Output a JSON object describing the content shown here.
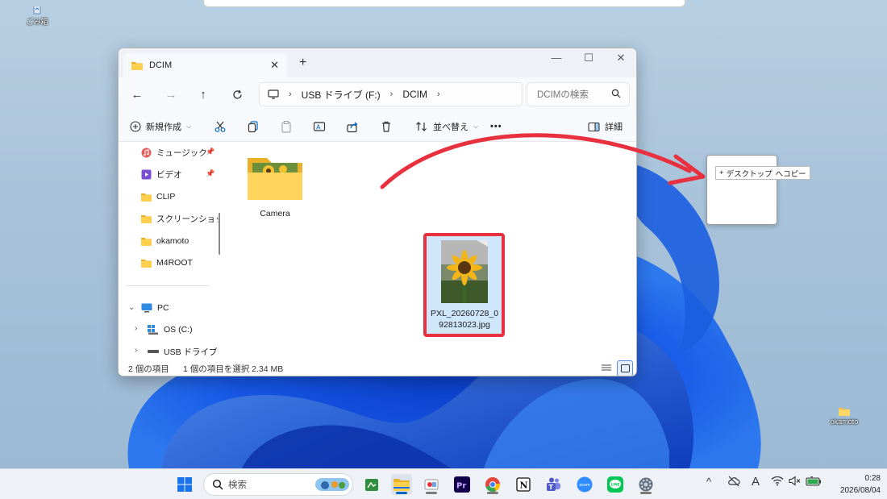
{
  "desktop": {
    "recycle_bin_label": "ごみ箱",
    "folder_label": "okamoto"
  },
  "explorer": {
    "tab_title": "DCIM",
    "tab_close": "✕",
    "new_tab": "+",
    "address": [
      "USB ドライブ (F:)",
      "DCIM"
    ],
    "search_placeholder": "DCIMの検索",
    "commands": {
      "new": "新規作成",
      "sort": "並べ替え",
      "more": "•••",
      "details": "詳細"
    },
    "sidebar": {
      "items": [
        {
          "label": "ミュージック",
          "icon": "music-icon",
          "pinned": true
        },
        {
          "label": "ビデオ",
          "icon": "video-icon",
          "pinned": true
        },
        {
          "label": "CLIP",
          "icon": "folder-icon"
        },
        {
          "label": "スクリーンショット",
          "icon": "folder-icon"
        },
        {
          "label": "okamoto",
          "icon": "folder-icon"
        },
        {
          "label": "M4ROOT",
          "icon": "folder-icon"
        }
      ],
      "pc_label": "PC",
      "drives": [
        "OS (C:)",
        "USB ドライブ (F:)"
      ]
    },
    "files": [
      {
        "name": "Camera",
        "type": "folder"
      },
      {
        "name_line1": "PXL_20260728_0",
        "name_line2": "92813023.jpg",
        "type": "image",
        "selected": true
      }
    ],
    "status": {
      "item_count": "2 個の項目",
      "selection": "1 個の項目を選択  2.34 MB"
    }
  },
  "drag": {
    "tooltip_plus": "+",
    "tooltip_target": "デスクトップ",
    "tooltip_action": "へコピー"
  },
  "taskbar": {
    "search_placeholder": "検索",
    "ime_indicator": "A",
    "time": "0:28",
    "date": "2026/08/04",
    "apps": [
      "start-icon",
      "search-widget-icon",
      "sticky-app-icon",
      "file-explorer-icon",
      "snipping-tool-icon",
      "premiere-pro-icon",
      "chrome-icon",
      "notion-icon",
      "teams-icon",
      "zoom-icon",
      "line-icon",
      "settings-icon"
    ]
  },
  "colors": {
    "highlight": "#e8303f",
    "selection_bg": "#cfe6fb",
    "accent": "#0067c0"
  }
}
